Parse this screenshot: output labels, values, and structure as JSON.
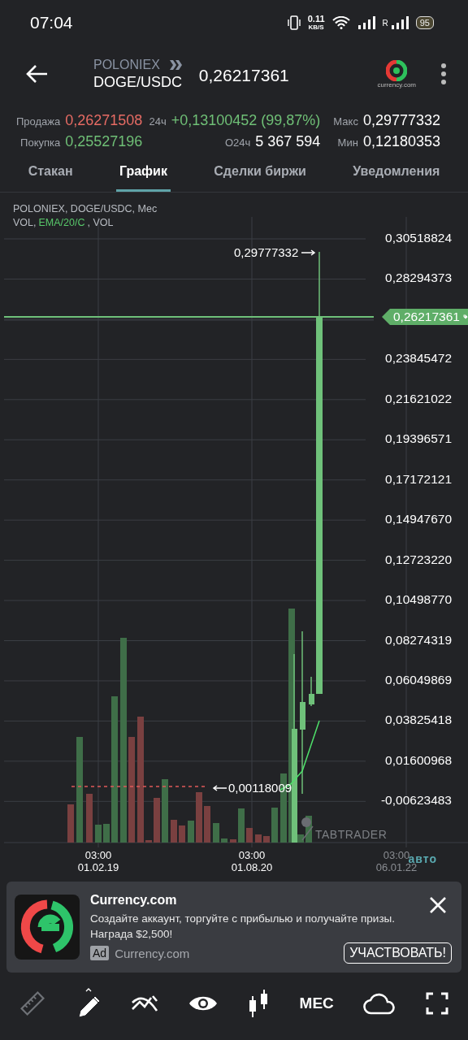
{
  "status_bar": {
    "time": "07:04",
    "net_speed": "0.11",
    "net_unit": "KB/S",
    "roaming": "R",
    "battery": "95"
  },
  "header": {
    "exchange": "POLONIEX",
    "pair": "DOGE/USDC",
    "price": "0,26217361",
    "logo_caption": "currency.com"
  },
  "stats": {
    "sell_label": "Продажа",
    "sell_value": "0,26271508",
    "buy_label": "Покупка",
    "buy_value": "0,25527196",
    "change_label": "24ч",
    "change_value": "+0,13100452 (99,87%)",
    "volume_label": "О24ч",
    "volume_value": "5 367 594",
    "max_label": "Макс",
    "max_value": "0,29777332",
    "min_label": "Мин",
    "min_value": "0,12180353"
  },
  "tabs": [
    {
      "label": "Стакан",
      "selected": false
    },
    {
      "label": "График",
      "selected": true
    },
    {
      "label": "Сделки биржи",
      "selected": false
    },
    {
      "label": "Уведомления",
      "selected": false
    }
  ],
  "chart": {
    "legend": "POLONIEX, DOGE/USDC, Мес",
    "indicators": [
      {
        "label": "VOL,",
        "kind": "volume"
      },
      {
        "label": "EMA/20/C",
        "kind": "ema"
      },
      {
        "label": ", VOL",
        "kind": "volume"
      }
    ],
    "price_ticks": [
      "0,30518824",
      "0,28294373",
      "0,23845472",
      "0,21621022",
      "0,19396571",
      "0,17172121",
      "0,14947670",
      "0,12723220",
      "0,10498770",
      "0,08274319",
      "0,06049869",
      "0,03825418",
      "0,01600968",
      "-0,00623483"
    ],
    "current_price": "0,26217361",
    "high_marker": "0,29777332",
    "low_marker": "0,00118009",
    "watermark": "TABTRADER",
    "time_labels": [
      {
        "time": "03:00",
        "date": "01.02.19"
      },
      {
        "time": "03:00",
        "date": "01.08.20"
      },
      {
        "time": "03:00",
        "date": "06.01.22"
      }
    ],
    "scale_mode": "авто"
  },
  "ad": {
    "title": "Currency.com",
    "body": "Создайте аккаунт, торгуйте с прибылью и получайте призы. Награда $2,500!",
    "badge": "Ad",
    "advertiser": "Currency.com",
    "cta": "УЧАСТВОВАТЬ!"
  },
  "toolbar": [
    {
      "kind": "ruler",
      "disabled": true
    },
    {
      "kind": "pencil",
      "disabled": false
    },
    {
      "kind": "indicator",
      "disabled": false
    },
    {
      "kind": "eye",
      "disabled": false
    },
    {
      "kind": "candles",
      "disabled": false
    },
    {
      "kind": "text",
      "label": "МЕС",
      "disabled": false
    },
    {
      "kind": "cloud",
      "disabled": false
    },
    {
      "kind": "fullscreen",
      "disabled": false
    }
  ]
}
